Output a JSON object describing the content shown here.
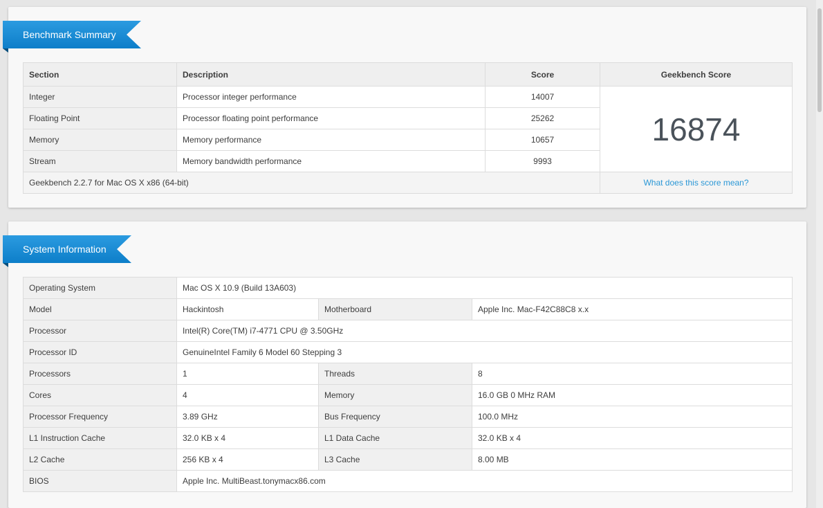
{
  "benchmark": {
    "title": "Benchmark Summary",
    "headers": {
      "section": "Section",
      "description": "Description",
      "score": "Score",
      "geekbench_score": "Geekbench Score"
    },
    "rows": [
      {
        "section": "Integer",
        "description": "Processor integer performance",
        "score": "14007"
      },
      {
        "section": "Floating Point",
        "description": "Processor floating point performance",
        "score": "25262"
      },
      {
        "section": "Memory",
        "description": "Memory performance",
        "score": "10657"
      },
      {
        "section": "Stream",
        "description": "Memory bandwidth performance",
        "score": "9993"
      }
    ],
    "total_score": "16874",
    "version": "Geekbench 2.2.7 for Mac OS X x86 (64-bit)",
    "help_link": "What does this score mean?"
  },
  "system": {
    "title": "System Information",
    "os_label": "Operating System",
    "os_value": "Mac OS X 10.9 (Build 13A603)",
    "model_label": "Model",
    "model_value": "Hackintosh",
    "motherboard_label": "Motherboard",
    "motherboard_value": "Apple Inc. Mac-F42C88C8 x.x",
    "processor_label": "Processor",
    "processor_value": "Intel(R) Core(TM) i7-4771 CPU @ 3.50GHz",
    "processor_id_label": "Processor ID",
    "processor_id_value": "GenuineIntel Family 6 Model 60 Stepping 3",
    "processors_label": "Processors",
    "processors_value": "1",
    "threads_label": "Threads",
    "threads_value": "8",
    "cores_label": "Cores",
    "cores_value": "4",
    "memory_label": "Memory",
    "memory_value": "16.0 GB 0 MHz RAM",
    "freq_label": "Processor Frequency",
    "freq_value": "3.89 GHz",
    "bus_label": "Bus Frequency",
    "bus_value": "100.0 MHz",
    "l1i_label": "L1 Instruction Cache",
    "l1i_value": "32.0 KB x 4",
    "l1d_label": "L1 Data Cache",
    "l1d_value": "32.0 KB x 4",
    "l2_label": "L2 Cache",
    "l2_value": "256 KB x 4",
    "l3_label": "L3 Cache",
    "l3_value": "8.00 MB",
    "bios_label": "BIOS",
    "bios_value": "Apple Inc. MultiBeast.tonymacx86.com"
  },
  "colors": {
    "ribbon": "#1a8fd8",
    "link": "#2a97d6",
    "score": "#4a525a"
  }
}
